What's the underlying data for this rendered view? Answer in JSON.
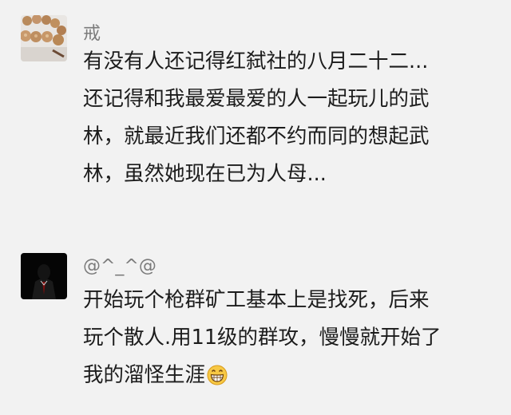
{
  "comments": [
    {
      "avatar_icon": "prayer-beads-avatar",
      "username": "戒",
      "lines": [
        "有没有人还记得红弑社的八月二十二...",
        "还记得和我最爱最爱的人一起玩儿的武",
        "林，就最近我们还都不约而同的想起武",
        "林，虽然她现在已为人母..."
      ]
    },
    {
      "avatar_icon": "dark-figure-avatar",
      "username": "@^_^@",
      "lines": [
        "开始玩个枪群矿工基本上是找死，后来",
        "玩个散人.用11级的群攻，慢慢就开始了",
        "我的溜怪生涯"
      ],
      "trailing_emoji": "grinning-face-icon"
    }
  ]
}
